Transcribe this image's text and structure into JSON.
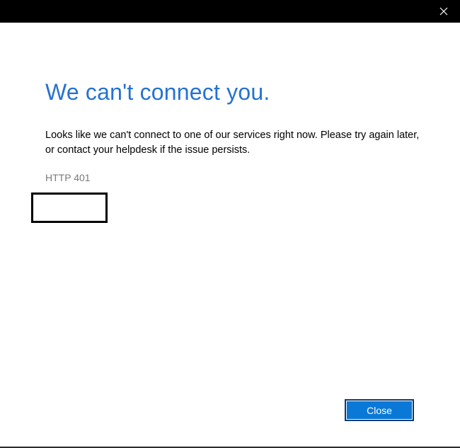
{
  "window": {
    "close_icon": "close-icon"
  },
  "dialog": {
    "title": "We can't connect you.",
    "message": "Looks like we can't connect to one of our services right now. Please try again later, or contact your helpdesk if the issue persists.",
    "error_code": "HTTP 401"
  },
  "buttons": {
    "close_label": "Close"
  },
  "colors": {
    "title_bar": "#000000",
    "heading": "#2672d0",
    "button_bg": "#0a78d7",
    "error_code": "#7a7a7a"
  }
}
